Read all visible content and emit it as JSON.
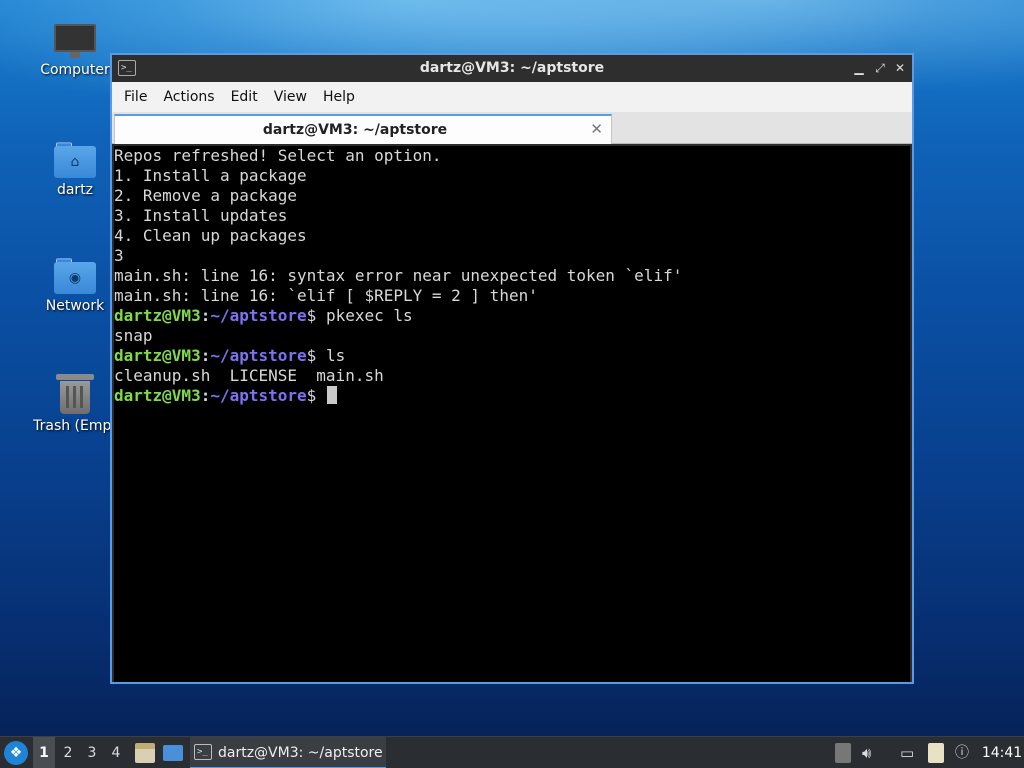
{
  "desktop": {
    "icons": [
      {
        "label": "Computer",
        "icon": "computer-icon"
      },
      {
        "label": "dartz",
        "icon": "home-folder-icon"
      },
      {
        "label": "Network",
        "icon": "network-folder-icon"
      },
      {
        "label": "Trash (Empt",
        "icon": "trash-icon"
      }
    ]
  },
  "window": {
    "title": "dartz@VM3: ~/aptstore",
    "controls": {
      "minimize": "▁",
      "maximize": "⤢",
      "close": "✕"
    },
    "menu": [
      "File",
      "Actions",
      "Edit",
      "View",
      "Help"
    ],
    "tab": {
      "title": "dartz@VM3: ~/aptstore",
      "close": "✕"
    }
  },
  "terminal": {
    "prompt": {
      "user": "dartz@VM3",
      "sep": ":",
      "path": "~/aptstore",
      "symbol": "$ "
    },
    "output": [
      "Repos refreshed! Select an option.",
      "1. Install a package",
      "2. Remove a package",
      "3. Install updates",
      "4. Clean up packages",
      "3",
      "main.sh: line 16: syntax error near unexpected token `elif'",
      "main.sh: line 16: `elif [ $REPLY = 2 ] then'"
    ],
    "cmd1": "pkexec ls",
    "out1": "snap",
    "cmd2": "ls",
    "out2": "cleanup.sh  LICENSE  main.sh"
  },
  "taskbar": {
    "workspaces": [
      "1",
      "2",
      "3",
      "4"
    ],
    "active_workspace": "1",
    "task_label": "dartz@VM3: ~/aptstore",
    "clock": "14:41"
  },
  "colors": {
    "prompt_user": "#7fdc45",
    "prompt_path": "#7b73f0",
    "window_accent": "#5a9be6"
  }
}
